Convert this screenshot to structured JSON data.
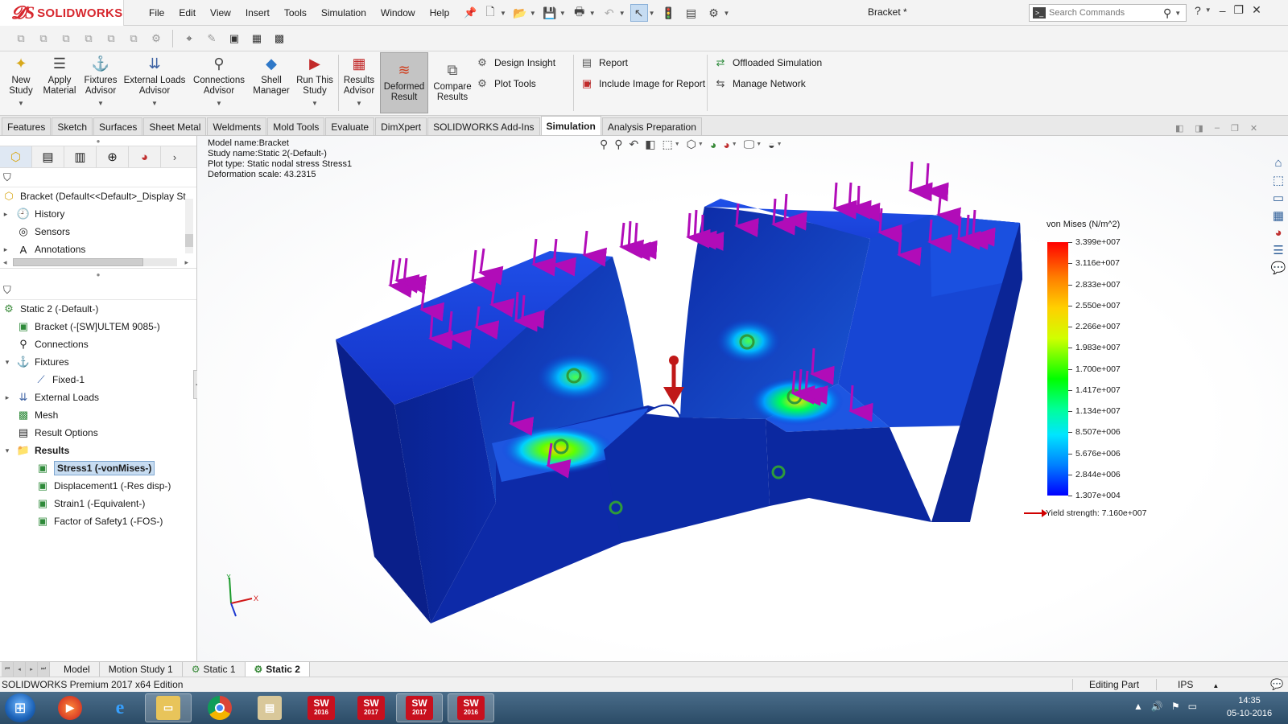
{
  "app": {
    "brand": "SOLIDWORKS",
    "document_title": "Bracket *"
  },
  "menu": [
    "File",
    "Edit",
    "View",
    "Insert",
    "Tools",
    "Simulation",
    "Window",
    "Help"
  ],
  "search": {
    "placeholder": "Search Commands"
  },
  "command_manager": {
    "big_buttons": [
      {
        "label": "New\nStudy",
        "icon": "new-study-icon"
      },
      {
        "label": "Apply\nMaterial",
        "icon": "apply-material-icon"
      },
      {
        "label": "Fixtures\nAdvisor",
        "icon": "fixtures-advisor-icon"
      },
      {
        "label": "External Loads\nAdvisor",
        "icon": "external-loads-icon"
      },
      {
        "label": "Connections\nAdvisor",
        "icon": "connections-icon"
      },
      {
        "label": "Shell\nManager",
        "icon": "shell-manager-icon"
      },
      {
        "label": "Run This\nStudy",
        "icon": "run-study-icon"
      },
      {
        "label": "Results\nAdvisor",
        "icon": "results-advisor-icon"
      },
      {
        "label": "Deformed\nResult",
        "icon": "deformed-result-icon"
      },
      {
        "label": "Compare\nResults",
        "icon": "compare-results-icon"
      }
    ],
    "design_insight": "Design Insight",
    "plot_tools": "Plot Tools",
    "report": "Report",
    "include_image": "Include Image for Report",
    "offloaded_simulation": "Offloaded Simulation",
    "manage_network": "Manage Network"
  },
  "tabs": [
    "Features",
    "Sketch",
    "Surfaces",
    "Sheet Metal",
    "Weldments",
    "Mold Tools",
    "Evaluate",
    "DimXpert",
    "SOLIDWORKS Add-Ins",
    "Simulation",
    "Analysis Preparation"
  ],
  "active_tab": "Simulation",
  "feature_tree": {
    "root": "Bracket  (Default<<Default>_Display St",
    "items": [
      "History",
      "Sensors",
      "Annotations"
    ]
  },
  "study_tree": {
    "study": "Static 2 (-Default-)",
    "part": "Bracket (-[SW]ULTEM 9085-)",
    "connections": "Connections",
    "fixtures": "Fixtures",
    "fixed": "Fixed-1",
    "external_loads": "External Loads",
    "mesh": "Mesh",
    "result_options": "Result Options",
    "results": "Results",
    "result_items": [
      "Stress1 (-vonMises-)",
      "Displacement1 (-Res disp-)",
      "Strain1 (-Equivalent-)",
      "Factor of Safety1 (-FOS-)"
    ]
  },
  "plot_info": {
    "model_name": "Model name:Bracket",
    "study_name": "Study name:Static 2(-Default-)",
    "plot_type": "Plot type: Static nodal stress Stress1",
    "deformation_scale": "Deformation scale: 43.2315"
  },
  "legend": {
    "title": "von Mises (N/m^2)",
    "values": [
      "3.399e+007",
      "3.116e+007",
      "2.833e+007",
      "2.550e+007",
      "2.266e+007",
      "1.983e+007",
      "1.700e+007",
      "1.417e+007",
      "1.134e+007",
      "8.507e+006",
      "5.676e+006",
      "2.844e+006",
      "1.307e+004"
    ],
    "yield": "Yield strength: 7.160e+007"
  },
  "triad": {
    "x": "X",
    "y": "Y"
  },
  "bottom_tabs": [
    "Model",
    "Motion Study 1",
    "Static 1",
    "Static 2"
  ],
  "active_bottom_tab": "Static 2",
  "status": {
    "edition": "SOLIDWORKS Premium 2017 x64 Edition",
    "mode": "Editing Part",
    "units": "IPS"
  },
  "taskbar": {
    "apps": [
      {
        "name": "media-player-icon"
      },
      {
        "name": "internet-explorer-icon"
      },
      {
        "name": "file-explorer-icon"
      },
      {
        "name": "chrome-icon"
      },
      {
        "name": "folder-icon"
      },
      {
        "sw_version": "2016"
      },
      {
        "sw_version": "2017"
      },
      {
        "sw_version": "2017"
      },
      {
        "sw_version": "2016"
      }
    ],
    "time": "14:35",
    "date": "05-10-2016"
  },
  "colors": {
    "brand_red": "#d7282f",
    "load_arrow": "#b10cb8",
    "fixture_green": "#2e9b3a",
    "model_blue": "#0b2fbf",
    "selection_blue": "#c7dcf1"
  }
}
